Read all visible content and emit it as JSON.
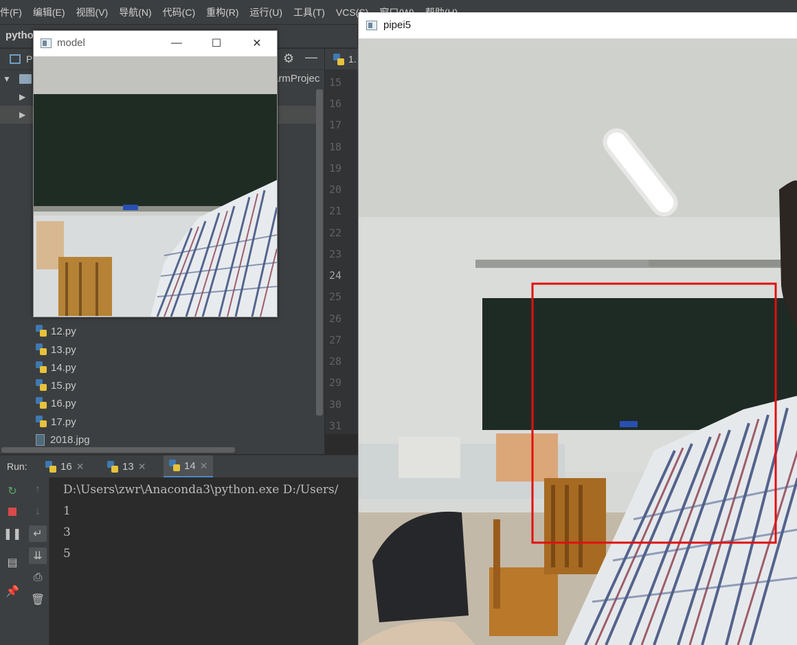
{
  "menu": [
    "件(F)",
    "编辑(E)",
    "视图(V)",
    "导航(N)",
    "代码(C)",
    "重构(R)",
    "运行(U)",
    "工具(T)",
    "VCS(S)",
    "窗口(W)",
    "帮助(H)"
  ],
  "breadcrumb": "pytho",
  "project_panel": {
    "tab_label": "P",
    "root_suffix": "armProjec",
    "files": [
      "12.py",
      "13.py",
      "14.py",
      "15.py",
      "16.py",
      "17.py",
      "2018.jpg"
    ]
  },
  "editor": {
    "tab_label": "1.",
    "line_numbers": [
      "15",
      "16",
      "17",
      "18",
      "19",
      "20",
      "21",
      "22",
      "23",
      "24",
      "25",
      "26",
      "27",
      "28",
      "29",
      "30",
      "31"
    ],
    "current_line": "24"
  },
  "run_panel": {
    "label": "Run:",
    "tabs": [
      {
        "label": "16"
      },
      {
        "label": "13"
      },
      {
        "label": "14"
      }
    ],
    "console_lines": [
      "D:\\Users\\zwr\\Anaconda3\\python.exe D:/Users/",
      "1",
      "3",
      "5"
    ]
  },
  "windows": {
    "model": {
      "title": "model"
    },
    "pipei5": {
      "title": "pipei5"
    }
  },
  "colors": {
    "ide_bg": "#2b2b2b",
    "panel_bg": "#3c3f41",
    "match_box": "#e01010",
    "active_tab_underline": "#4a88c7"
  },
  "icons": [
    "python-file-icon",
    "image-file-icon",
    "folder-icon",
    "gear-icon",
    "rerun-icon",
    "stop-icon",
    "pause-icon",
    "window-icon",
    "minimize-icon",
    "maximize-icon",
    "close-icon"
  ]
}
